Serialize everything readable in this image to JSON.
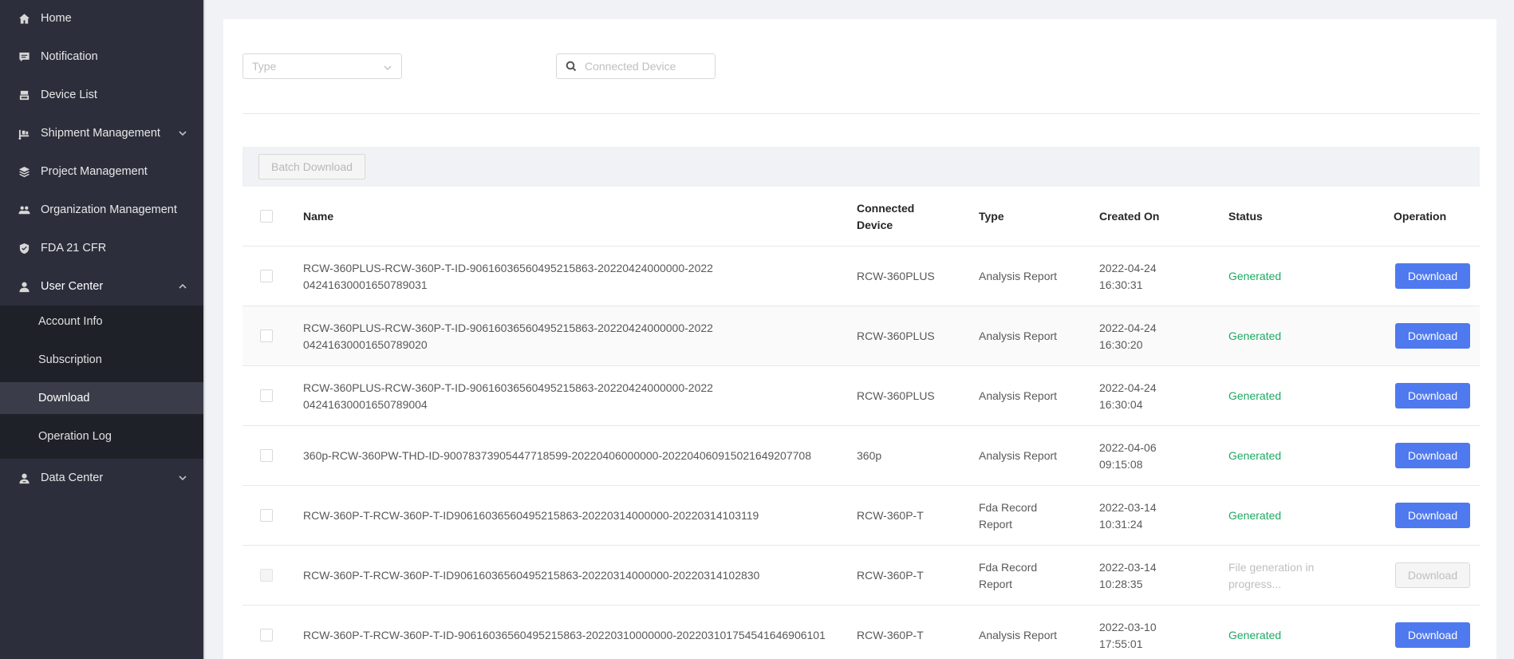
{
  "sidebar": {
    "items": [
      {
        "label": "Home",
        "icon": "home-icon"
      },
      {
        "label": "Notification",
        "icon": "message-icon"
      },
      {
        "label": "Device List",
        "icon": "device-icon"
      },
      {
        "label": "Shipment Management",
        "icon": "truck-icon"
      },
      {
        "label": "Project Management",
        "icon": "layers-icon"
      },
      {
        "label": "Organization Management",
        "icon": "team-icon"
      },
      {
        "label": "FDA 21 CFR",
        "icon": "shield-icon"
      },
      {
        "label": "User Center",
        "icon": "user-icon"
      },
      {
        "label": "Data Center",
        "icon": "data-user-icon"
      }
    ],
    "user_center_sub": [
      {
        "label": "Account Info"
      },
      {
        "label": "Subscription"
      },
      {
        "label": "Download"
      },
      {
        "label": "Operation Log"
      }
    ],
    "active": "Download"
  },
  "filters": {
    "type_placeholder": "Type",
    "device_placeholder": "Connected Device"
  },
  "toolbar": {
    "batch_download": "Batch Download"
  },
  "table": {
    "headers": {
      "name": "Name",
      "device": "Connected Device",
      "type": "Type",
      "created": "Created On",
      "status": "Status",
      "operation": "Operation"
    },
    "rows": [
      {
        "name": "RCW-360PLUS-RCW-360P-T-ID-906160365604952158​63-20220424000000-20220424163000​1650789031",
        "device": "RCW-360PLUS",
        "type": "Analysis Report",
        "created": "2022-04-24 16:30:31",
        "status": "Generated",
        "action": "Download"
      },
      {
        "name": "RCW-360PLUS-RCW-360P-T-ID-906160365604952158​63-20220424000000-20220424163000​1650789020",
        "device": "RCW-360PLUS",
        "type": "Analysis Report",
        "created": "2022-04-24 16:30:20",
        "status": "Generated",
        "action": "Download"
      },
      {
        "name": "RCW-360PLUS-RCW-360P-T-ID-906160365604952158​63-20220424000000-20220424163000​1650789004",
        "device": "RCW-360PLUS",
        "type": "Analysis Report",
        "created": "2022-04-24 16:30:04",
        "status": "Generated",
        "action": "Download"
      },
      {
        "name": "360p-RCW-360PW-THD-ID-9007837390544771859​9-20220406000000-20220406091502​1649207708",
        "device": "360p",
        "type": "Analysis Report",
        "created": "2022-04-06 09:15:08",
        "status": "Generated",
        "action": "Download"
      },
      {
        "name": "RCW-360P-T-RCW-360P-T-ID90616036560495215863-20220314000000-20220314103119",
        "device": "RCW-360P-T",
        "type": "Fda Record Report",
        "created": "2022-03-14 10:31:24",
        "status": "Generated",
        "action": "Download"
      },
      {
        "name": "RCW-360P-T-RCW-360P-T-ID90616036560495215863-20220314000000-20220314102830",
        "device": "RCW-360P-T",
        "type": "Fda Record Report",
        "created": "2022-03-14 10:28:35",
        "status": "File generation in progress...",
        "action": "Download"
      },
      {
        "name": "RCW-360P-T-RCW-360P-T-ID-90616036560495215863-20220310000000-20220310175454​1646906101",
        "device": "RCW-360P-T",
        "type": "Analysis Report",
        "created": "2022-03-10 17:55:01",
        "status": "Generated",
        "action": "Download"
      }
    ]
  },
  "colors": {
    "sidebar_bg": "#2c2f3b",
    "primary": "#4f79ee",
    "success": "#1eaa63"
  }
}
